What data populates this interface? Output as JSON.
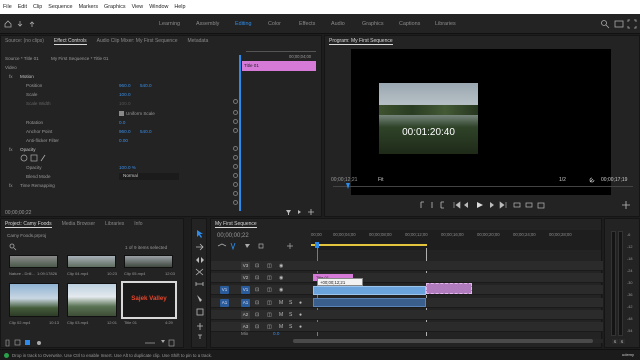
{
  "menu": [
    "File",
    "Edit",
    "Clip",
    "Sequence",
    "Markers",
    "Graphics",
    "View",
    "Window",
    "Help"
  ],
  "workspaces": [
    {
      "label": "Learning",
      "active": false
    },
    {
      "label": "Assembly",
      "active": false
    },
    {
      "label": "Editing",
      "active": true
    },
    {
      "label": "Color",
      "active": false
    },
    {
      "label": "Effects",
      "active": false
    },
    {
      "label": "Audio",
      "active": false
    },
    {
      "label": "Graphics",
      "active": false
    },
    {
      "label": "Captions",
      "active": false
    },
    {
      "label": "Libraries",
      "active": false
    }
  ],
  "source_panel": {
    "tabs": [
      "Source: (no clips)",
      "Effect Controls",
      "Audio Clip Mixer: My First Sequence",
      "Metadata"
    ],
    "breadcrumb_source": "Source * Title 01",
    "breadcrumb_seq": "My First Sequence * Title 01",
    "mini_clip_label": "Title 01",
    "mini_ruler_time": "00;00;04;00",
    "section_video": "Video",
    "section_motion": "Motion",
    "props": [
      {
        "label": "Position",
        "value": "960.0",
        "value2": "540.0"
      },
      {
        "label": "Scale",
        "value": "100.0",
        "value2": ""
      },
      {
        "label": "Scale Width",
        "value": "100.0",
        "value2": ""
      },
      {
        "label": "Uniform Scale",
        "value": "",
        "value2": ""
      },
      {
        "label": "Rotation",
        "value": "0.0",
        "value2": ""
      },
      {
        "label": "Anchor Point",
        "value": "960.0",
        "value2": "540.0"
      },
      {
        "label": "Anti-flicker Filter",
        "value": "0.00",
        "value2": ""
      }
    ],
    "section_opacity": "Opacity",
    "opacity_label": "Opacity",
    "opacity_value": "100.0 %",
    "blend_label": "Blend Mode",
    "blend_value": "Normal",
    "time_remap": "Time Remapping",
    "timecode": "00;00;00;22"
  },
  "program_monitor": {
    "title": "Program: My First Sequence",
    "overlay_text": "00:01:20:40",
    "timecode_left": "00;00;12;21",
    "fit": "Fit",
    "page": "1/2",
    "timecode_right": "00;00;17;19"
  },
  "project_panel": {
    "tabs": [
      "Project: Camy Foods",
      "Media Browser",
      "Libraries",
      "Info"
    ],
    "project_file": "Camy Foods.prproj",
    "selection_count": "1 of 9 items selected",
    "items": [
      {
        "name": "Nature - Drill...",
        "duration": "1:09:17826"
      },
      {
        "name": "Clip 04.mp4",
        "duration": "10:23"
      },
      {
        "name": "Clip 05.mp4",
        "duration": "12:03"
      },
      {
        "name": "Clip 02.mp4",
        "duration": "10:13"
      },
      {
        "name": "Clip 03.mp4",
        "duration": "12:01"
      },
      {
        "name": "Title 01",
        "duration": "4:29",
        "title_text": "Sajek Valley"
      }
    ]
  },
  "timeline": {
    "tab": "My First Sequence",
    "timecode": "00;00;00;22",
    "ruler": [
      "00;00",
      "00;00;04;00",
      "00;00;08;00",
      "00;00;12;00",
      "00;00;16;00",
      "00;00;20;00",
      "00;00;24;00",
      "00;00;28;00"
    ],
    "tracks": [
      {
        "name": "V3",
        "type": "video"
      },
      {
        "name": "V2",
        "type": "video"
      },
      {
        "name": "V1",
        "type": "video"
      },
      {
        "name": "A1",
        "type": "audio"
      },
      {
        "name": "A2",
        "type": "audio"
      },
      {
        "name": "A3",
        "type": "audio"
      },
      {
        "name": "Mix",
        "type": "mix",
        "value": "0.0"
      }
    ],
    "v2_clip": "Title 01",
    "tooltip": "+00;00;12;21",
    "audio_meter_labels": [
      "-6",
      "-12",
      "-18",
      "-24",
      "-30",
      "-36",
      "-42",
      "-48",
      "-54"
    ]
  },
  "status_bar": "Drop in track to Overwrite. Use Ctrl to enable Insert. Use Alt to duplicate clip. Use Shift to pin to a track.",
  "colors": {
    "accent": "#2d8ceb",
    "title_clip": "#d67ad8",
    "sel_clip": "#b07cbd",
    "video_clip": "#6ba3dd"
  }
}
